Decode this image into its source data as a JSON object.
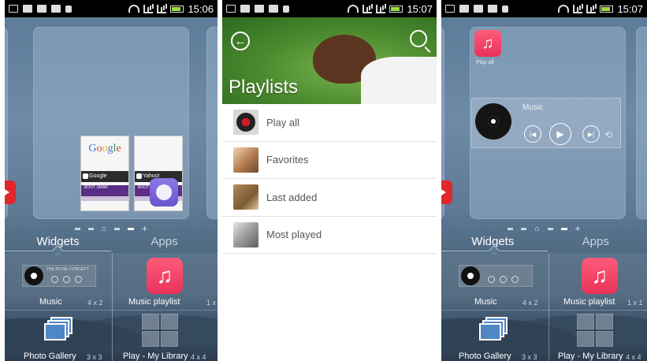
{
  "status_bar": [
    {
      "time": "15:06"
    },
    {
      "time": "15:07"
    },
    {
      "time": "15:07"
    }
  ],
  "tabs": {
    "widgets": "Widgets",
    "apps": "Apps"
  },
  "widgets": {
    "music": {
      "label": "Music",
      "size": "4 x 2"
    },
    "music_playlist": {
      "label": "Music playlist",
      "size": "1 x 1"
    },
    "photo_gallery": {
      "label": "Photo Gallery",
      "size": "3 x 3"
    },
    "play_library": {
      "label": "Play - My Library",
      "size": "4 x 4"
    }
  },
  "previews": {
    "google_logo": [
      "G",
      "o",
      "o",
      "g",
      "l",
      "e"
    ],
    "google_bar": "Google",
    "yahoo_bar": "Yahoo!",
    "purple_text": "BOOT SMAR",
    "mini_title": "THE ROYAL CONCEPT"
  },
  "playlists": {
    "title": "Playlists",
    "items": [
      {
        "label": "Play all"
      },
      {
        "label": "Favorites"
      },
      {
        "label": "Last added"
      },
      {
        "label": "Most played"
      }
    ]
  },
  "home": {
    "playall_label": "Play all",
    "music_widget_title": "Music"
  },
  "colors": {
    "accent_pink": "#e8325a",
    "launcher_bg": "#5d7c99"
  }
}
